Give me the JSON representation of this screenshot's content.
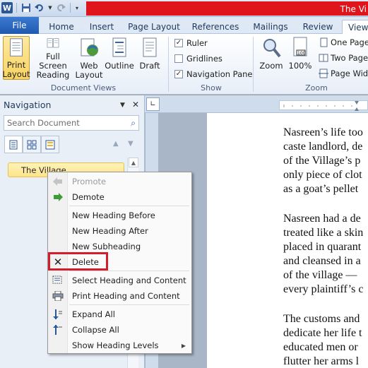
{
  "window": {
    "title": "The Vi"
  },
  "qat": {
    "app_icon": "W",
    "icons": [
      "save-icon",
      "undo-icon",
      "redo-icon",
      "customize-qat-icon"
    ]
  },
  "tabs": [
    {
      "label": "File"
    },
    {
      "label": "Home"
    },
    {
      "label": "Insert"
    },
    {
      "label": "Page Layout"
    },
    {
      "label": "References"
    },
    {
      "label": "Mailings"
    },
    {
      "label": "Review"
    },
    {
      "label": "View"
    }
  ],
  "ribbon": {
    "document_views": {
      "label": "Document Views",
      "buttons": [
        {
          "label": "Print\nLayout",
          "line1": "Print",
          "line2": "Layout"
        },
        {
          "label": "Full Screen Reading",
          "line1": "Full Screen",
          "line2": "Reading"
        },
        {
          "label": "Web Layout",
          "line1": "Web",
          "line2": "Layout"
        },
        {
          "label": "Outline",
          "line1": "Outline",
          "line2": ""
        },
        {
          "label": "Draft",
          "line1": "Draft",
          "line2": ""
        }
      ]
    },
    "show": {
      "label": "Show",
      "ruler": "Ruler",
      "ruler_checked": "✓",
      "gridlines": "Gridlines",
      "navigation_pane": "Navigation Pane",
      "navigation_checked": "✓"
    },
    "zoom": {
      "label": "Zoom",
      "zoom_button": "Zoom",
      "hundred_button": "100%",
      "one_page": "One Page",
      "two_pages": "Two Pages",
      "page_width": "Page Widt"
    }
  },
  "nav": {
    "title": "Navigation",
    "search_placeholder": "Search Document",
    "heading": "The Village"
  },
  "context_menu": {
    "promote": "Promote",
    "demote": "Demote",
    "new_heading_before": "New Heading Before",
    "new_heading_after": "New Heading After",
    "new_subheading": "New Subheading",
    "delete": "Delete",
    "select_heading": "Select Heading and Content",
    "print_heading": "Print Heading and Content",
    "expand_all": "Expand All",
    "collapse_all": "Collapse All",
    "show_heading_levels": "Show Heading Levels"
  },
  "document": {
    "lines": [
      "Nasreen’s life too",
      "caste landlord, de",
      "of the Village’s p",
      "only piece of clot",
      "as a goat’s pellet",
      "Nasreen had a de",
      "treated like a skin",
      "placed in quarant",
      "and cleansed in a",
      "of the village —",
      "every plaintiff’s c",
      "The customs and",
      "dedicate her life t",
      "educated men or",
      "flutter her arms l"
    ]
  }
}
